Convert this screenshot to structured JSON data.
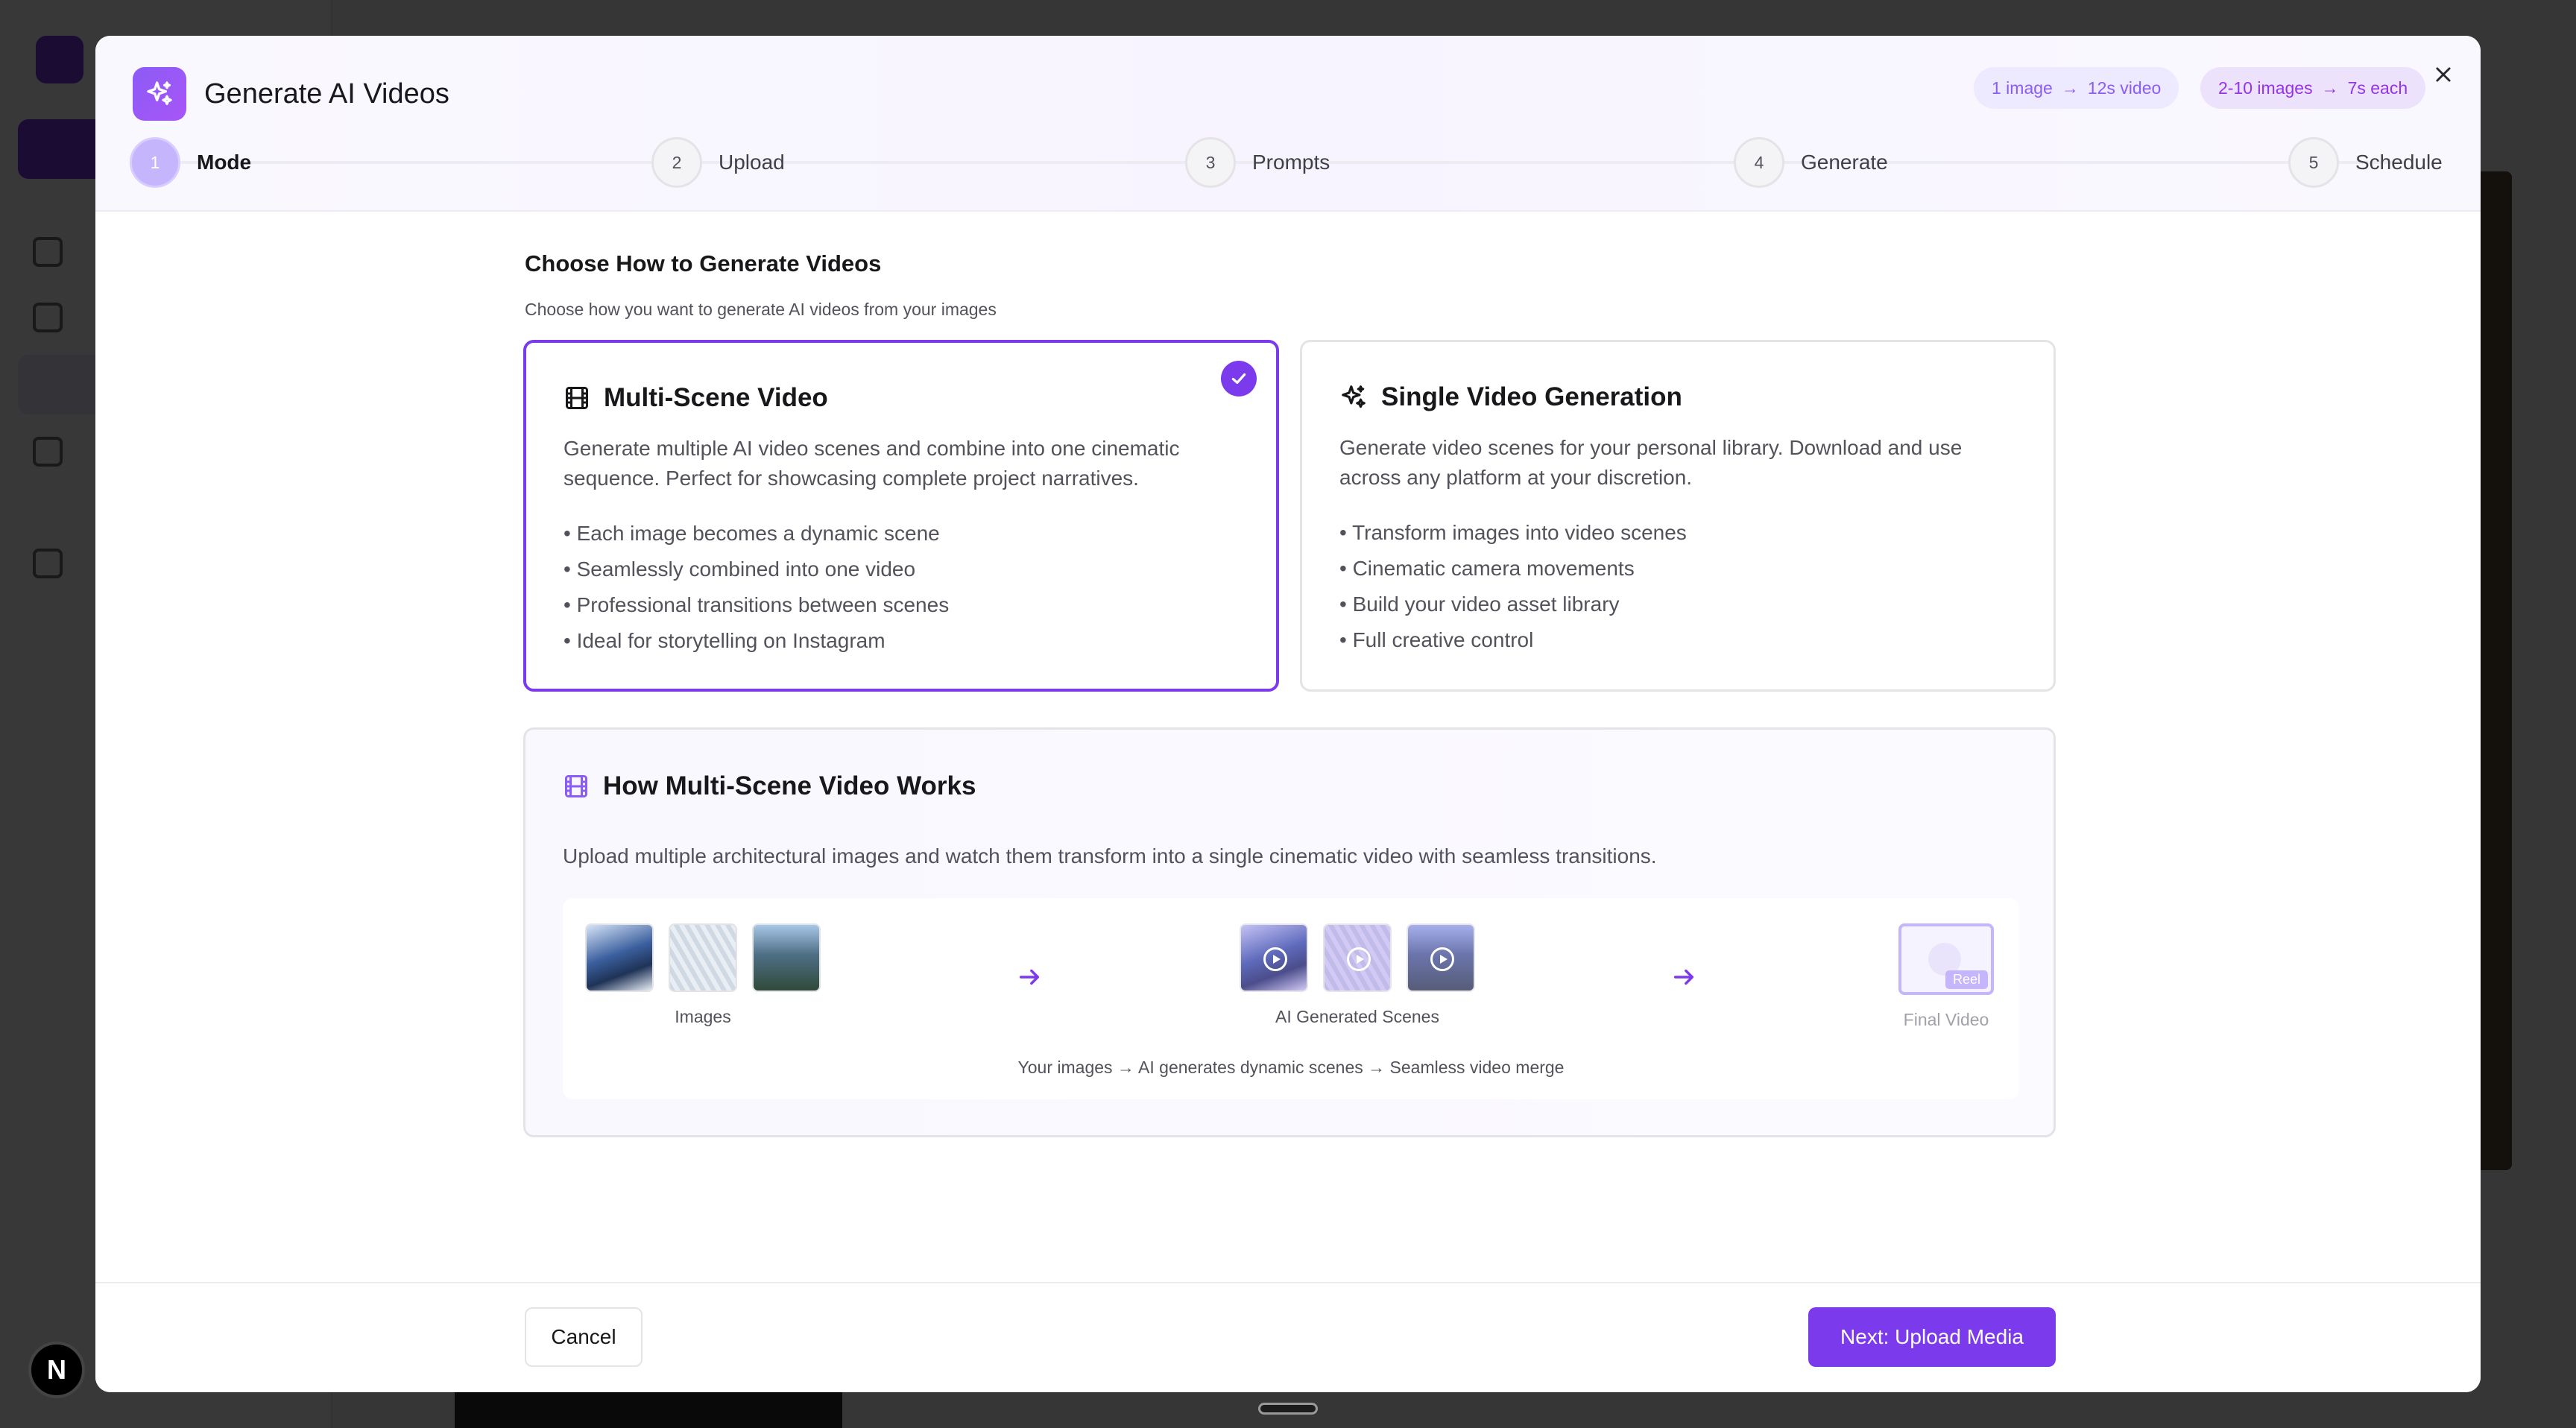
{
  "modal": {
    "title": "Generate AI Videos",
    "pills": [
      {
        "from": "1 image",
        "arrow": "→",
        "to": "12s video"
      },
      {
        "from": "2-10 images",
        "arrow": "→",
        "to": "7s each"
      }
    ],
    "steps": [
      {
        "number": "1",
        "label": "Mode",
        "active": true
      },
      {
        "number": "2",
        "label": "Upload",
        "active": false
      },
      {
        "number": "3",
        "label": "Prompts",
        "active": false
      },
      {
        "number": "4",
        "label": "Generate",
        "active": false
      },
      {
        "number": "5",
        "label": "Schedule",
        "active": false
      }
    ]
  },
  "content": {
    "title": "Choose How to Generate Videos",
    "subtitle": "Choose how you want to generate AI videos from your images",
    "options": [
      {
        "title": "Multi-Scene Video",
        "icon": "film-icon",
        "selected": true,
        "description": "Generate multiple AI video scenes and combine into one cinematic sequence. Perfect for showcasing complete project narratives.",
        "bullets": [
          "• Each image becomes a dynamic scene",
          "• Seamlessly combined into one video",
          "• Professional transitions between scenes",
          "• Ideal for storytelling on Instagram"
        ]
      },
      {
        "title": "Single Video Generation",
        "icon": "sparkles-icon",
        "selected": false,
        "description": "Generate video scenes for your personal library. Download and use across any platform at your discretion.",
        "bullets": [
          "• Transform images into video scenes",
          "• Cinematic camera movements",
          "• Build your video asset library",
          "• Full creative control"
        ]
      }
    ],
    "how_it_works": {
      "title": "How Multi-Scene Video Works",
      "description": "Upload multiple architectural images and watch them transform into a single cinematic video with seamless transitions.",
      "images_label": "Images",
      "scenes_label": "AI Generated Scenes",
      "final_label": "Final Video",
      "final_badge": "Reel",
      "caption": "Your images → AI generates dynamic scenes → Seamless video merge"
    }
  },
  "footer": {
    "cancel_label": "Cancel",
    "next_label": "Next: Upload Media"
  },
  "background": {
    "badge_letter": "N"
  },
  "colors": {
    "accent": "#7c3aed",
    "accent_light": "#ede9fe"
  }
}
